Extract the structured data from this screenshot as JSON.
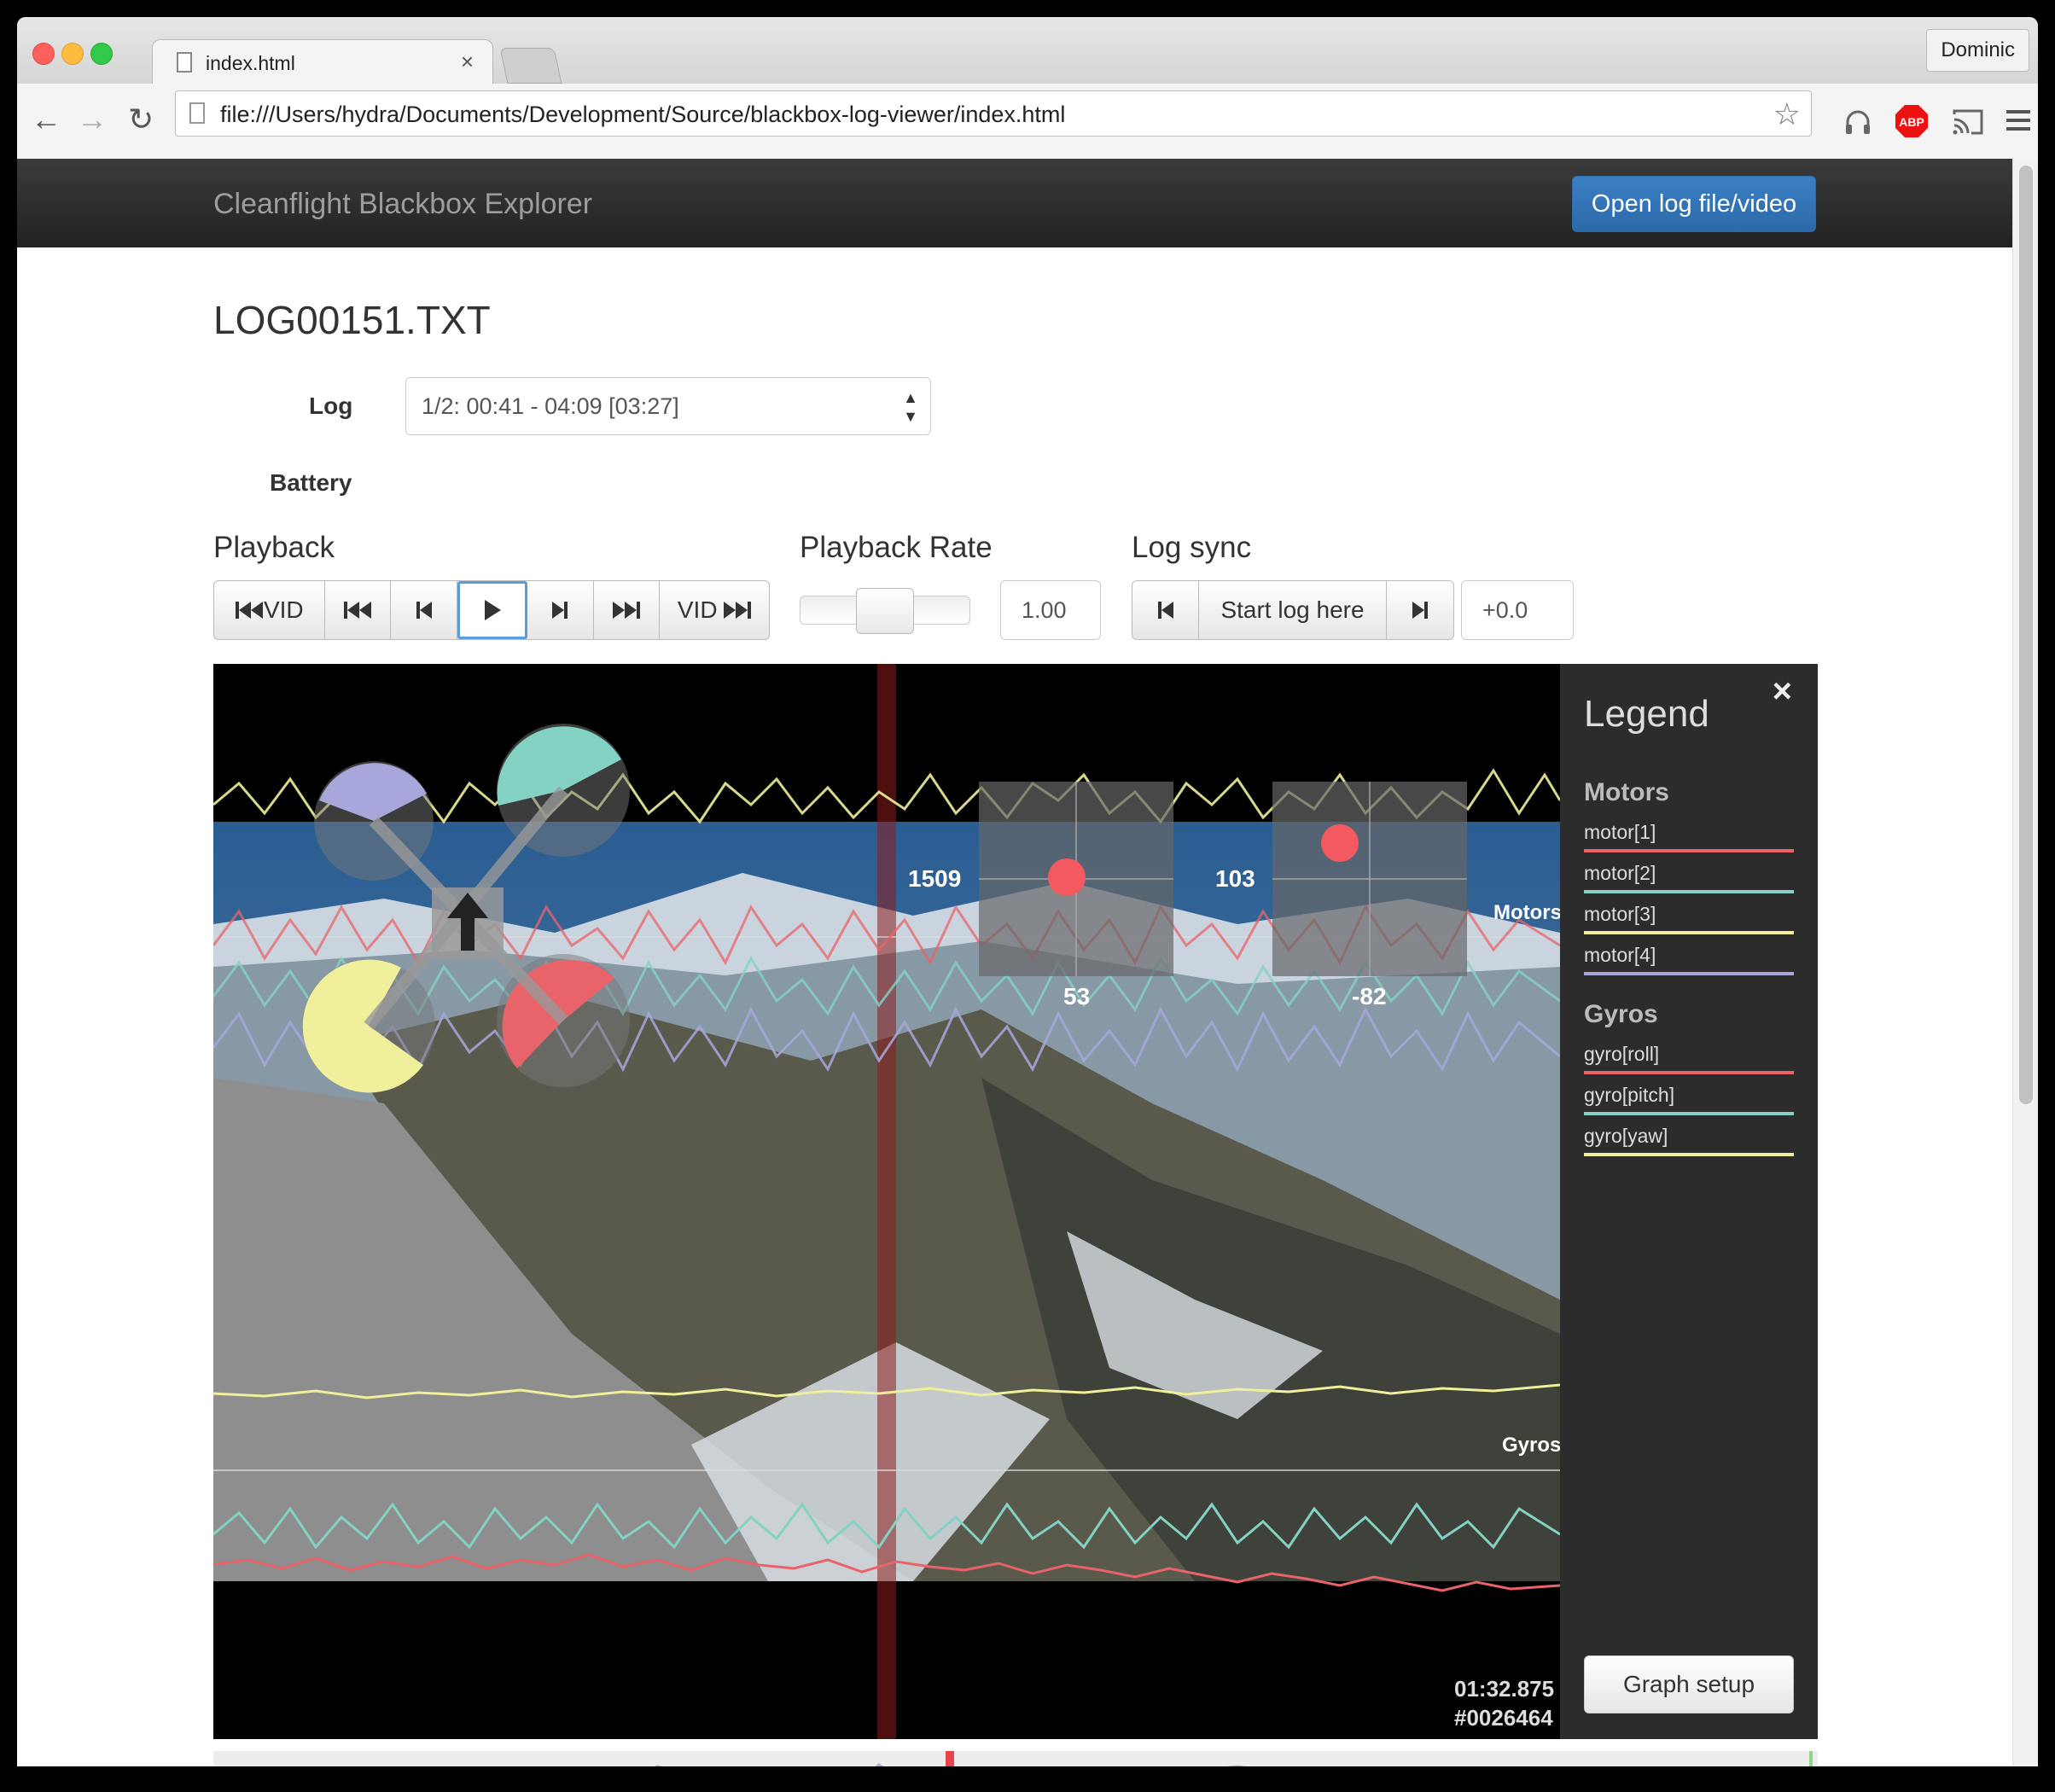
{
  "browser": {
    "tab_title": "index.html",
    "tab_close": "×",
    "user": "Dominic",
    "url": "file:///Users/hydra/Documents/Development/Source/blackbox-log-viewer/index.html",
    "ext_abp": "ABP"
  },
  "app": {
    "brand": "Cleanflight Blackbox Explorer",
    "open_button": "Open log file/video",
    "file_name": "LOG00151.TXT",
    "log_label": "Log",
    "log_selected": "1/2: 00:41 - 04:09 [03:27]",
    "battery_label": "Battery",
    "playback_title": "Playback",
    "playback_buttons": [
      "VID",
      "",
      "",
      "",
      "",
      "",
      "VID"
    ],
    "rate_title": "Playback Rate",
    "rate_value": "1.00",
    "rate_slider_fraction": 0.5,
    "sync_title": "Log sync",
    "sync_start": "Start log here",
    "sync_offset": "+0.0"
  },
  "graph": {
    "overlay_values": [
      "1509",
      "103",
      "53",
      "-82"
    ],
    "motors_label": "Motors",
    "gyros_label": "Gyros",
    "time": "01:32.875",
    "frame": "#0026464",
    "legend": {
      "title": "Legend",
      "close": "×",
      "groups": [
        {
          "name": "Motors",
          "items": [
            {
              "label": "motor[1]",
              "color": "#e8646a"
            },
            {
              "label": "motor[2]",
              "color": "#84d2c4"
            },
            {
              "label": "motor[3]",
              "color": "#f0ef9b"
            },
            {
              "label": "motor[4]",
              "color": "#a7a7dc"
            }
          ]
        },
        {
          "name": "Gyros",
          "items": [
            {
              "label": "gyro[roll]",
              "color": "#e8646a"
            },
            {
              "label": "gyro[pitch]",
              "color": "#84d2c4"
            },
            {
              "label": "gyro[yaw]",
              "color": "#f0ef9b"
            }
          ]
        }
      ],
      "setup_button": "Graph setup"
    }
  }
}
